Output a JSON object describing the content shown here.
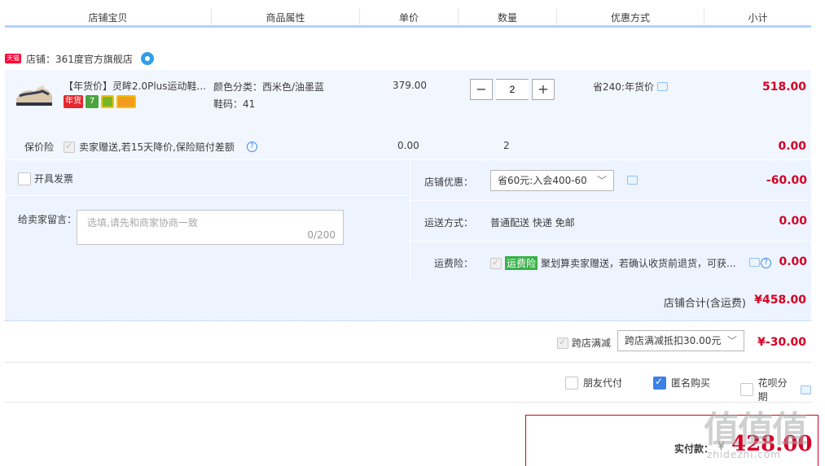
{
  "header": {
    "cols": [
      "店铺宝贝",
      "商品属性",
      "单价",
      "数量",
      "优惠方式",
      "小计"
    ]
  },
  "shop": {
    "badge": "天猫",
    "name": "店铺：361度官方旗舰店"
  },
  "item": {
    "title": "【年货价】灵眸2.0Plus运动鞋...",
    "tags": [
      "年货",
      "7",
      "",
      ""
    ],
    "color_attr": "颜色分类：西米色/油墨蓝",
    "size_attr": "鞋码：41",
    "price": "379.00",
    "qty_minus": "−",
    "qty": "2",
    "qty_plus": "+",
    "discount": "省240:年货价",
    "subtotal": "518.00"
  },
  "insurance": {
    "label": "保价险",
    "desc": "卖家赠送,若15天降价,保险赔付差额",
    "help": "?",
    "price": "0.00",
    "qty": "2",
    "subtotal": "0.00"
  },
  "order": {
    "invoice_label": "开具发票",
    "message_label": "给卖家留言：",
    "message_placeholder": "选填,请先和商家协商一致",
    "message_count": "0/200",
    "shop_discount_label": "店铺优惠：",
    "shop_discount_value": "省60元:入会400-60",
    "shop_discount_amount": "-60.00",
    "delivery_label": "运送方式：",
    "delivery_value": "普通配送 快递 免邮",
    "delivery_amount": "0.00",
    "freight_ins_label": "运费险：",
    "freight_ins_tag": "运费险",
    "freight_ins_desc": "聚划算卖家赠送，若确认收货前退货，可获...",
    "freight_ins_amount": "0.00"
  },
  "shop_total": {
    "label": "店铺合计(含运费)",
    "amount": "¥458.00"
  },
  "cross_store": {
    "label": "跨店满减",
    "select_value": "跨店满减抵扣30.00元",
    "amount": "¥-30.00"
  },
  "pay_options": {
    "friend_pay": "朋友代付",
    "anonymous": "匿名购买",
    "huabei": "花呗分期"
  },
  "payment": {
    "label": "实付款：",
    "currency": "¥",
    "amount": "428.00"
  },
  "watermark": {
    "big": "值值值",
    "small": "zhidezhi.com"
  },
  "colors": {
    "price_red": "#d40026",
    "accent_blue": "#3c80e8",
    "panel_bg": "#edf4ff"
  }
}
